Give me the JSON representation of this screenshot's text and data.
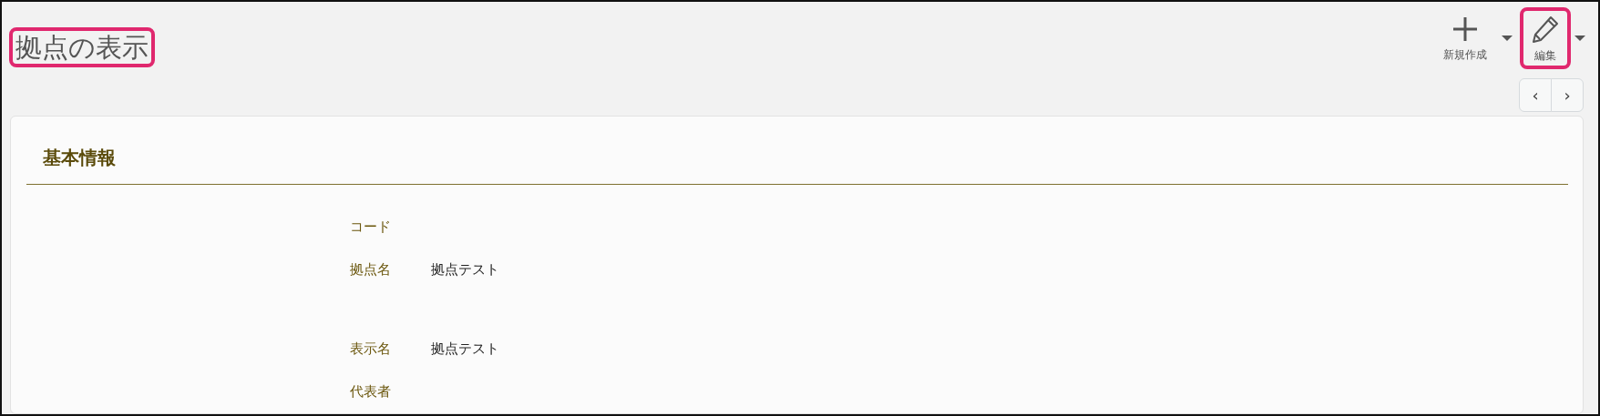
{
  "page_title": {
    "text": "拠点の表示",
    "highlighted": true
  },
  "toolbar": [
    {
      "kind": "new",
      "label": "新規作成",
      "highlighted": false
    },
    {
      "kind": "edit",
      "label": "編集",
      "highlighted": true
    }
  ],
  "pager": [
    {
      "label": "‹"
    },
    {
      "label": "›"
    }
  ],
  "section": {
    "title": "基本情報",
    "field_groups": [
      [
        {
          "label": "コード"
        },
        {
          "label": "拠点名",
          "value": "拠点テスト"
        }
      ],
      [
        {
          "label": "表示名",
          "value": "拠点テスト"
        },
        {
          "label": "代表者"
        }
      ]
    ]
  }
}
